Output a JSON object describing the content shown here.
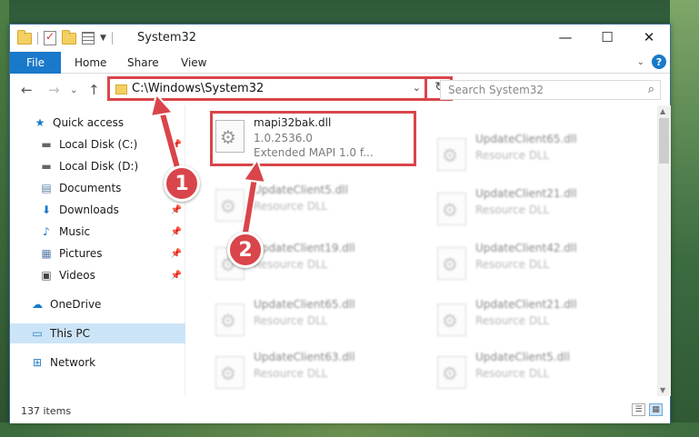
{
  "title": "System32",
  "ribbon": {
    "file": "File",
    "tabs": [
      "Home",
      "Share",
      "View"
    ]
  },
  "window_controls": {
    "minimize": "—",
    "maximize": "☐",
    "close": "✕"
  },
  "nav": {
    "back": "←",
    "forward": "→",
    "up": "↑"
  },
  "address": {
    "path": "C:\\Windows\\System32",
    "dropdown": "⌄",
    "refresh": "↻"
  },
  "search": {
    "placeholder": "Search System32",
    "icon": "⌕"
  },
  "sidebar": {
    "items": [
      {
        "label": "Quick access",
        "icon": "★"
      },
      {
        "label": "Local Disk (C:)",
        "icon": "▬"
      },
      {
        "label": "Local Disk (D:)",
        "icon": "▬"
      },
      {
        "label": "Documents",
        "icon": "▤"
      },
      {
        "label": "Downloads",
        "icon": "⬇"
      },
      {
        "label": "Music",
        "icon": "♪"
      },
      {
        "label": "Pictures",
        "icon": "▦"
      },
      {
        "label": "Videos",
        "icon": "▣"
      },
      {
        "label": "OneDrive",
        "icon": "☁"
      },
      {
        "label": "This PC",
        "icon": "▭"
      },
      {
        "label": "Network",
        "icon": "⊞"
      }
    ]
  },
  "files": {
    "selected": {
      "name": "mapi32bak.dll",
      "version": "1.0.2536.0",
      "desc": "Extended MAPI 1.0 f..."
    },
    "left_column": [
      {
        "name": "UpdateClient5.dll",
        "type": "Resource DLL"
      },
      {
        "name": "UpdateClient19.dll",
        "type": "Resource DLL"
      },
      {
        "name": "UpdateClient65.dll",
        "type": "Resource DLL"
      },
      {
        "name": "UpdateClient63.dll",
        "type": "Resource DLL"
      }
    ],
    "right_column": [
      {
        "name": "UpdateClient65.dll",
        "type": "Resource DLL"
      },
      {
        "name": "UpdateClient21.dll",
        "type": "Resource DLL"
      },
      {
        "name": "UpdateClient42.dll",
        "type": "Resource DLL"
      },
      {
        "name": "UpdateClient21.dll",
        "type": "Resource DLL"
      },
      {
        "name": "UpdateClient5.dll",
        "type": "Resource DLL"
      }
    ]
  },
  "status": {
    "items": "137 items"
  },
  "callouts": [
    "1",
    "2"
  ],
  "colors": {
    "accent": "#1979ca",
    "highlight": "#d9454a",
    "selection": "#cce4f7"
  }
}
